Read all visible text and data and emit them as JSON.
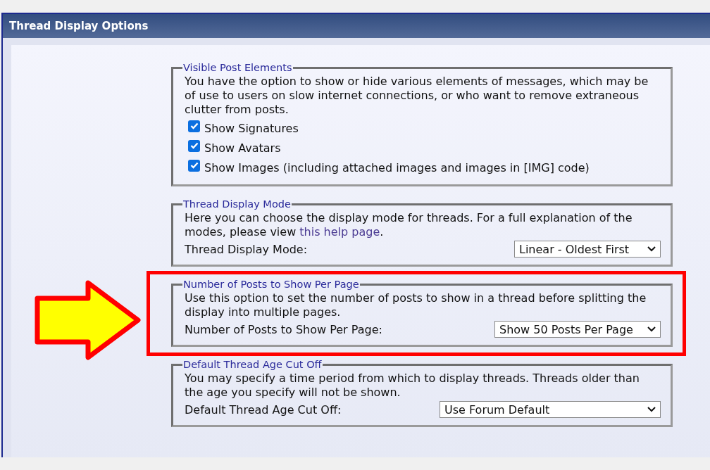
{
  "panel": {
    "title": "Thread Display Options"
  },
  "sections": [
    {
      "legend": "Visible Post Elements",
      "description": [
        {
          "kind": "text",
          "text": "You have the option to show or hide various elements of messages, which may be of use to users on slow internet connections, or who want to remove extraneous clutter from posts."
        }
      ],
      "highlighted": false,
      "checkboxes": [
        {
          "label": "Show Signatures",
          "checked": true
        },
        {
          "label": "Show Avatars",
          "checked": true
        },
        {
          "label": "Show Images (including attached images and images in [IMG] code)",
          "checked": true
        }
      ]
    },
    {
      "legend": "Thread Display Mode",
      "description": [
        {
          "kind": "text",
          "text": "Here you can choose the display mode for threads. For a full explanation of the modes, please view "
        },
        {
          "kind": "link",
          "text": "this help page"
        },
        {
          "kind": "text",
          "text": "."
        }
      ],
      "highlighted": false,
      "field": {
        "label": "Thread Display Mode:",
        "value": "Linear - Oldest First"
      }
    },
    {
      "legend": "Number of Posts to Show Per Page",
      "description": [
        {
          "kind": "text",
          "text": "Use this option to set the number of posts to show in a thread before splitting the display into multiple pages."
        }
      ],
      "highlighted": true,
      "field": {
        "label": "Number of Posts to Show Per Page:",
        "value": "Show 50 Posts Per Page"
      }
    },
    {
      "legend": "Default Thread Age Cut Off",
      "description": [
        {
          "kind": "text",
          "text": "You may specify a time period from which to display threads. Threads older than the age you specify will not be shown."
        }
      ],
      "highlighted": false,
      "field": {
        "label": "Default Thread Age Cut Off:",
        "value": "Use Forum Default"
      }
    }
  ]
}
